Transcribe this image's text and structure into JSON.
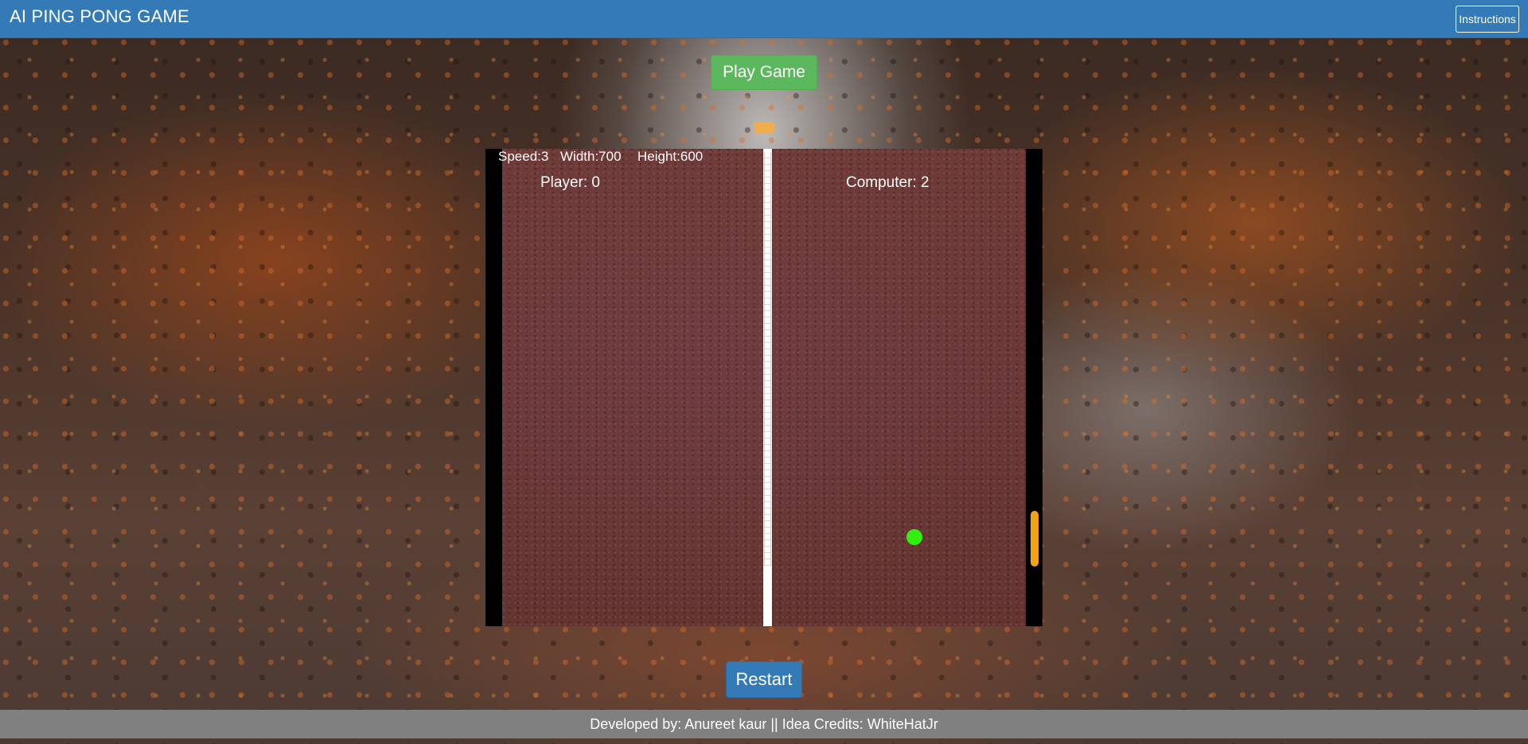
{
  "header": {
    "title": "AI PING PONG GAME",
    "instructions_label": "Instructions"
  },
  "controls": {
    "play_label": "Play Game",
    "restart_label": "Restart"
  },
  "game": {
    "speed_text": "Speed:3",
    "width_text": "Width:700",
    "height_text": "Height:600",
    "player_score_text": "Player: 0",
    "computer_score_text": "Computer: 2",
    "ball_color": "#33ee11",
    "paddle_color": "#f0a313"
  },
  "footer": {
    "text": "Developed by: Anureet kaur || Idea Credits: WhiteHatJr"
  },
  "colors": {
    "navbar": "#337ab7",
    "play_button": "#5cb85c",
    "restart_button": "#337ab7",
    "footer": "#808080"
  }
}
